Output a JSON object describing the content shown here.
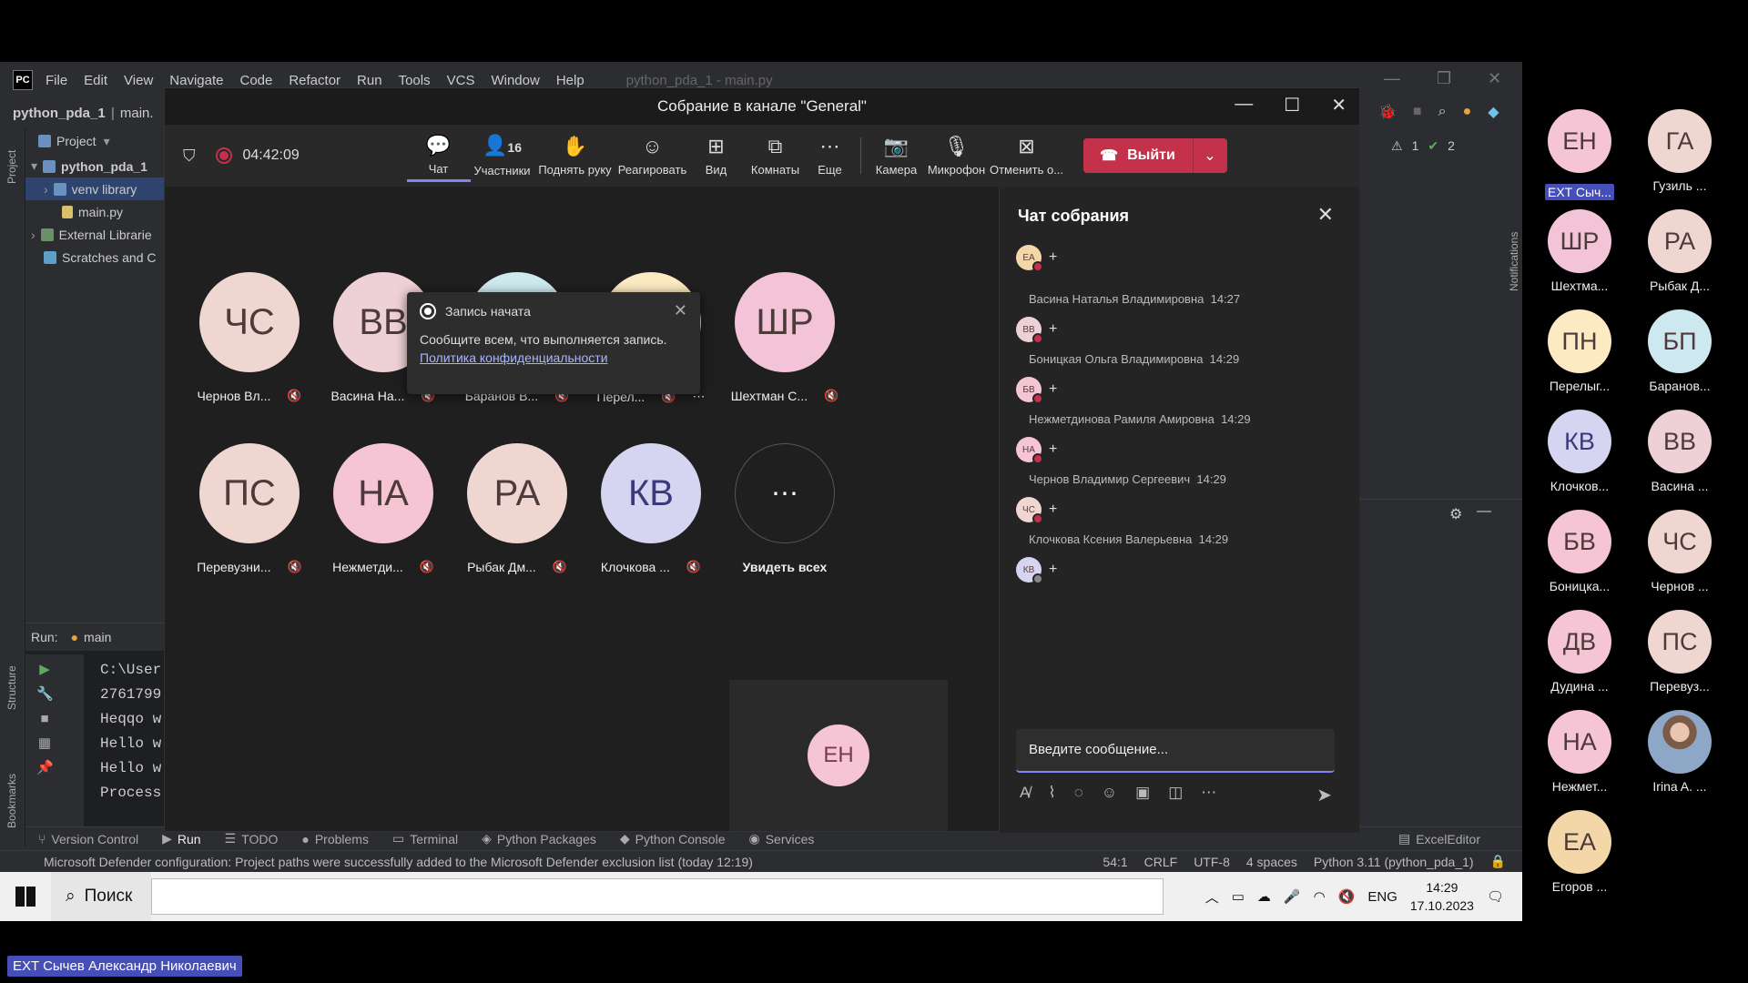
{
  "ide": {
    "menu": [
      "File",
      "Edit",
      "View",
      "Navigate",
      "Code",
      "Refactor",
      "Run",
      "Tools",
      "VCS",
      "Window",
      "Help"
    ],
    "window_title": "python_pda_1 - main.py",
    "breadcrumb_project": "python_pda_1",
    "breadcrumb_file": "main.",
    "project_label": "Project",
    "tree": [
      "python_pda_1",
      "venv  library",
      "main.py",
      "External Librarie",
      "Scratches and C"
    ],
    "run_label": "Run:",
    "run_config": "main",
    "console_lines": [
      "C:\\User",
      "2761799",
      "Heqqo w",
      "Hello w",
      "Hello w",
      "",
      "Process"
    ],
    "bottom_tools": [
      "Version Control",
      "Run",
      "TODO",
      "Problems",
      "Terminal",
      "Python Packages",
      "Python Console",
      "Services",
      "ExcelEditor"
    ],
    "status_message": "Microsoft Defender configuration: Project paths were successfully added to the Microsoft Defender exclusion list (today 12:19)",
    "status_right": [
      "54:1",
      "CRLF",
      "UTF-8",
      "4 spaces",
      "Python 3.11 (python_pda_1)"
    ],
    "inspection": [
      "1",
      "2"
    ],
    "left_vertical": [
      "Project",
      "Structure",
      "Bookmarks"
    ],
    "right_vertical": "Notifications"
  },
  "taskbar": {
    "search": "Поиск",
    "lang": "ENG",
    "time": "14:29",
    "date": "17.10.2023"
  },
  "meeting": {
    "title": "Собрание в канале \"General\"",
    "timer": "04:42:09",
    "toolbar": [
      {
        "label": "Чат",
        "icon": "chat-icon"
      },
      {
        "label": "Участники",
        "icon": "people-icon",
        "count": "16"
      },
      {
        "label": "Поднять руку",
        "icon": "hand-icon"
      },
      {
        "label": "Реагировать",
        "icon": "emoji-icon"
      },
      {
        "label": "Вид",
        "icon": "view-icon"
      },
      {
        "label": "Комнаты",
        "icon": "rooms-icon"
      },
      {
        "label": "Еще",
        "icon": "more-icon"
      }
    ],
    "camera": "Камера",
    "mic": "Микрофон",
    "cancel": "Отменить о...",
    "leave": "Выйти",
    "participants": [
      {
        "initials": "ЧС",
        "name": "Чернов Вл...",
        "color": "#f0d6d0"
      },
      {
        "initials": "ВВ",
        "name": "Васина На...",
        "color": "#eed1d6"
      },
      {
        "initials": "БП",
        "name": "Баранов В...",
        "color": "#cde9ef"
      },
      {
        "initials": "ПН",
        "name": "Перел...",
        "color": "#fbeac2"
      },
      {
        "initials": "ШР",
        "name": "Шехтман С...",
        "color": "#f3c4d7"
      },
      {
        "initials": "ПС",
        "name": "Перевузни...",
        "color": "#f0d6d0"
      },
      {
        "initials": "НА",
        "name": "Нежметди...",
        "color": "#f5c4d5"
      },
      {
        "initials": "РА",
        "name": "Рыбак Дм...",
        "color": "#f0d6d0"
      },
      {
        "initials": "КВ",
        "name": "Клочкова ...",
        "color": "#d5d5f2"
      }
    ],
    "see_all": "Увидеть всех",
    "self_initials": "ЕН",
    "toast": {
      "title": "Запись начата",
      "body": "Сообщите всем, что выполняется запись.",
      "link": "Политика конфиденциальности"
    }
  },
  "chat": {
    "title": "Чат собрания",
    "messages": [
      {
        "author": "",
        "time": "",
        "initials": "ЕА",
        "color": "#f3d7a8"
      },
      {
        "author": "Васина Наталья Владимировна",
        "time": "14:27",
        "initials": "ВВ",
        "color": "#eed1d6"
      },
      {
        "author": "Боницкая Ольга Владимировна",
        "time": "14:29",
        "initials": "БВ",
        "color": "#f5c4d5"
      },
      {
        "author": "Нежметдинова Рамиля Амировна",
        "time": "14:29",
        "initials": "НА",
        "color": "#f5c4d5"
      },
      {
        "author": "Чернов Владимир Сергеевич",
        "time": "14:29",
        "initials": "ЧС",
        "color": "#f0d6d0"
      },
      {
        "author": "Клочкова Ксения Валерьевна",
        "time": "14:29",
        "initials": "КВ",
        "color": "#d5d5f2"
      }
    ],
    "input_placeholder": "Введите сообщение..."
  },
  "side_strip": [
    {
      "initials": "ЕН",
      "name": "EXT Сыч...",
      "color": "#f5c4d5",
      "highlight": true
    },
    {
      "initials": "ГА",
      "name": "Гузиль ...",
      "color": "#f0d6d0"
    },
    {
      "initials": "ШР",
      "name": "Шехтма...",
      "color": "#f3c4d7"
    },
    {
      "initials": "РА",
      "name": "Рыбак Д...",
      "color": "#f0d6d0"
    },
    {
      "initials": "ПН",
      "name": "Перелыг...",
      "color": "#fbeac2"
    },
    {
      "initials": "БП",
      "name": "Баранов...",
      "color": "#cde9ef"
    },
    {
      "initials": "КВ",
      "name": "Клочков...",
      "color": "#d5d5f2"
    },
    {
      "initials": "ВВ",
      "name": "Васина ...",
      "color": "#eed1d6"
    },
    {
      "initials": "БВ",
      "name": "Боницка...",
      "color": "#f5c4d5"
    },
    {
      "initials": "ЧС",
      "name": "Чернов ...",
      "color": "#f0d6d0"
    },
    {
      "initials": "ДВ",
      "name": "Дудина ...",
      "color": "#f5c4d5"
    },
    {
      "initials": "ПС",
      "name": "Перевуз...",
      "color": "#f0d6d0"
    },
    {
      "initials": "НА",
      "name": "Нежмет...",
      "color": "#f5c4d5"
    },
    {
      "initials": "",
      "name": "Irina A. ...",
      "color": "#8ea7c7",
      "photo": true
    },
    {
      "initials": "ЕА",
      "name": "Егоров ...",
      "color": "#f3d7a8"
    }
  ],
  "presenter": "EXT Сычев Александр Николаевич"
}
